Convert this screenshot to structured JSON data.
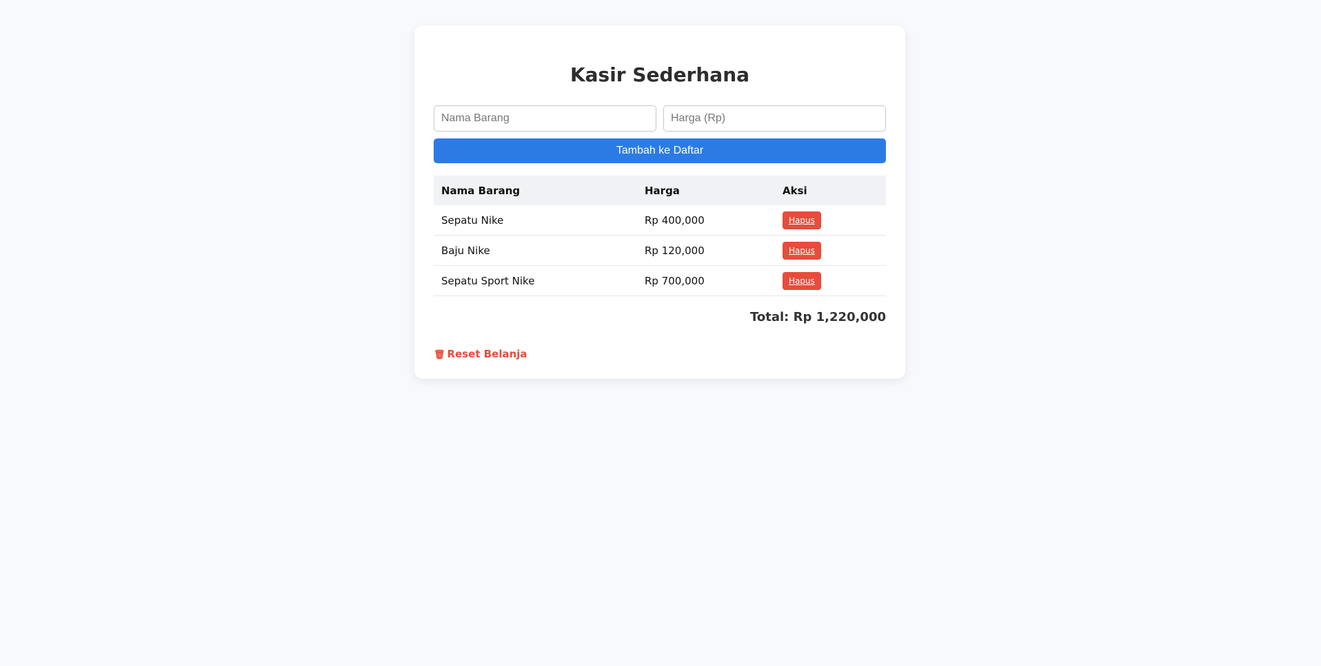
{
  "app": {
    "title": "Kasir Sederhana"
  },
  "form": {
    "name_placeholder": "Nama Barang",
    "name_value": "",
    "price_placeholder": "Harga (Rp)",
    "price_value": "",
    "add_label": "Tambah ke Daftar"
  },
  "table": {
    "headers": [
      "Nama Barang",
      "Harga",
      "Aksi"
    ],
    "rows": [
      {
        "name": "Sepatu Nike",
        "price": "Rp 400,000",
        "action": "Hapus"
      },
      {
        "name": "Baju Nike",
        "price": "Rp 120,000",
        "action": "Hapus"
      },
      {
        "name": "Sepatu Sport Nike",
        "price": "Rp 700,000",
        "action": "Hapus"
      }
    ]
  },
  "summary": {
    "total": "Total: Rp 1,220,000"
  },
  "reset": {
    "icon": "trash-icon",
    "icon_glyph": "🗑",
    "label": "Reset Belanja"
  },
  "colors": {
    "primary": "#2c7be5",
    "danger": "#e74c3c",
    "background": "#f7f9fc"
  }
}
